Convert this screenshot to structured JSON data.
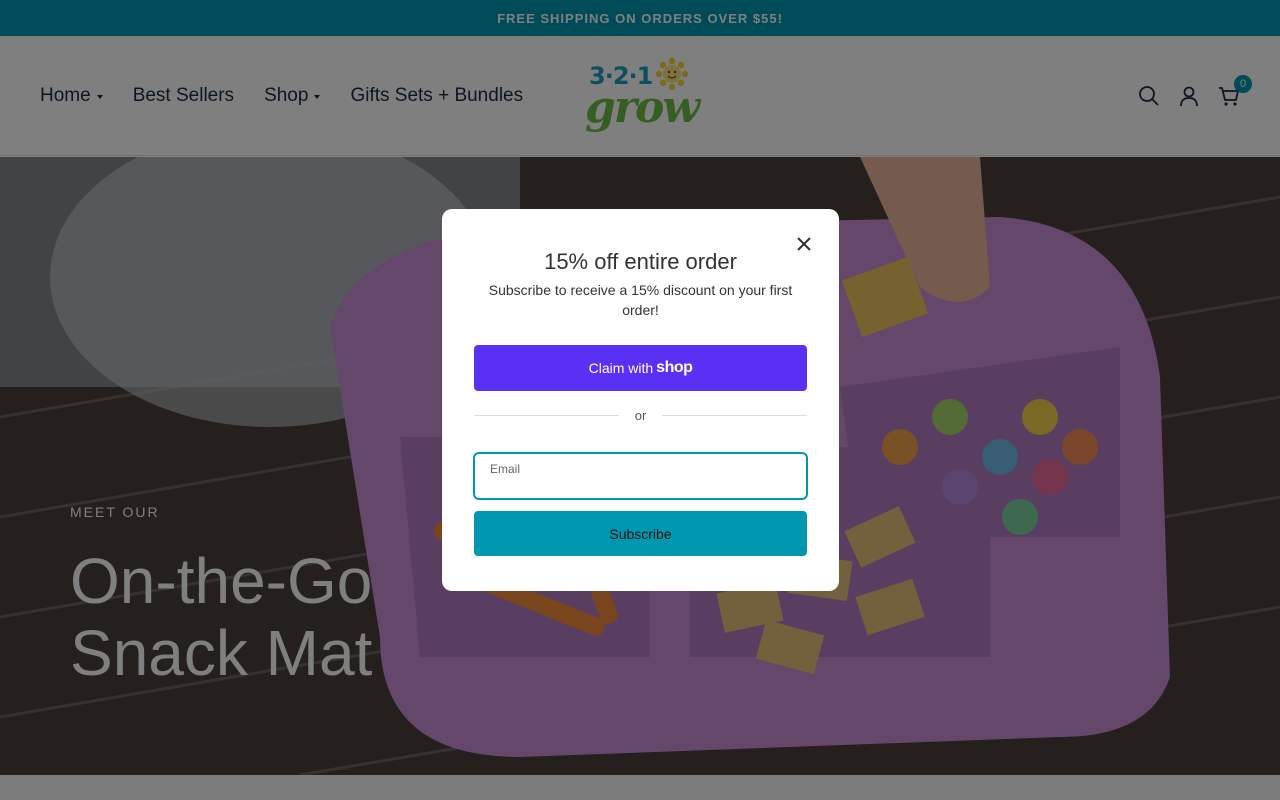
{
  "announcement": {
    "text": "FREE SHIPPING ON ORDERS OVER $55!"
  },
  "header": {
    "nav": [
      {
        "label": "Home",
        "has_dropdown": true
      },
      {
        "label": "Best Sellers",
        "has_dropdown": false
      },
      {
        "label": "Shop",
        "has_dropdown": true
      },
      {
        "label": "Gifts Sets + Bundles",
        "has_dropdown": false
      }
    ],
    "logo": {
      "numbers": "3·2·1",
      "word": "grow"
    },
    "icons": [
      "search-icon",
      "account-icon",
      "cart-icon"
    ],
    "cart_count": "0"
  },
  "hero": {
    "eyebrow": "MEET OUR",
    "title_line1": "On-the-Go",
    "title_line2": "Snack Mat"
  },
  "popup": {
    "title": "15% off entire order",
    "subtitle": "Subscribe to receive a 15% discount on your first order!",
    "claim_prefix": "Claim with",
    "claim_brand": "shop",
    "divider_text": "or",
    "email_label": "Email",
    "email_value": "",
    "subscribe_label": "Subscribe"
  },
  "colors": {
    "accent": "#0097b0",
    "shop_purple": "#5a31f4",
    "nav_text": "#1b2b44",
    "logo_blue": "#1a9ec0",
    "logo_green": "#6cba45"
  }
}
